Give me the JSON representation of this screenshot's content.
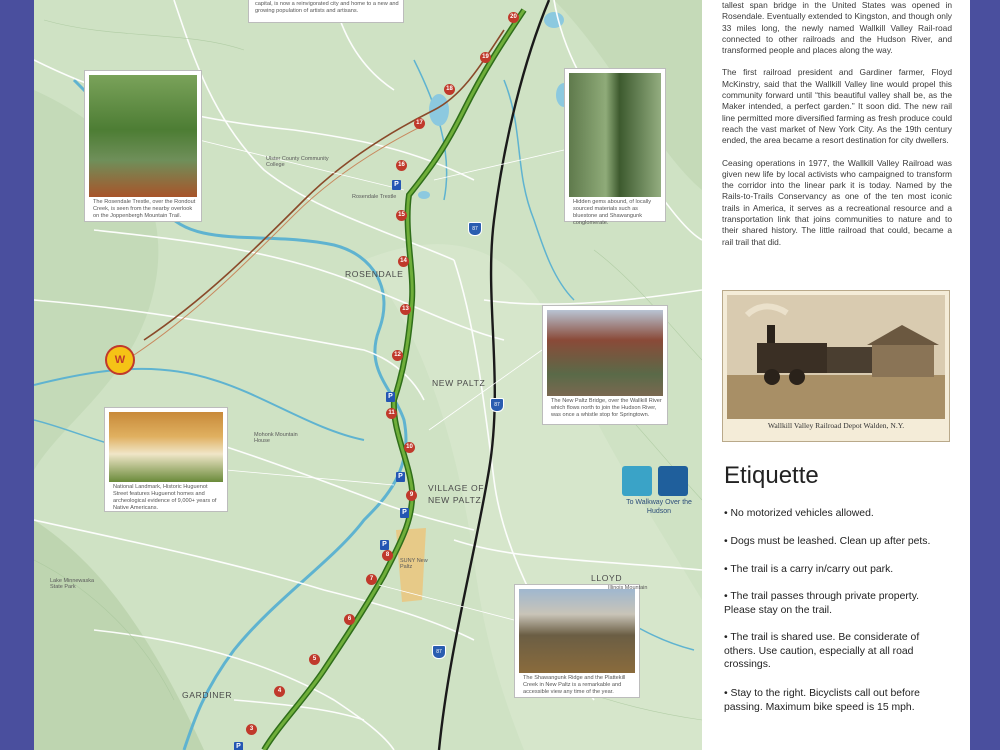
{
  "colors": {
    "border": "#4a4f9e",
    "terrain": "#cfe2c4",
    "trail": "#4f8a2b",
    "river": "#5fb3d0",
    "highway": "#1a1a1a",
    "rail_old": "#8a4a2a",
    "milemarker": "#c0392b",
    "parking": "#2456b3"
  },
  "top_caption": "capital, is now a reinvigorated city and home to a new and growing population of artists and artisans.",
  "story": [
    "tallest span bridge in the United States was opened in Rosendale. Eventually extended to Kingston, and though only 33 miles long, the newly named Wallkill Valley Rail-road connected to other railroads and the Hudson River, and transformed people and places along the way.",
    "The first railroad president and Gardiner farmer, Floyd McKinstry, said that the Wallkill Valley line would propel this community forward until “this beautiful valley shall be, as the Maker intended, a perfect garden.” It soon did. The new rail line permitted more diversified farming as fresh produce could reach the vast market of New York City. As the 19th century ended, the area became a resort destination for city dwellers.",
    "Ceasing operations in 1977, the Wallkill Valley Railroad was given new life by local activists who campaigned to transform the corridor into the linear park it is today. Named by the Rails-to-Trails Conservancy as one of the ten most iconic trails in America, it serves as a recreational resource and a transportation link that joins communities to nature and to their shared history. The little railroad that could, became a rail trail that did."
  ],
  "depot_caption": "Wallkill Valley Railroad Depot    Walden, N.Y.",
  "etiquette": {
    "title": "Etiquette",
    "rules": [
      "• No motorized vehicles allowed.",
      "• Dogs must be leashed. Clean up after pets.",
      "• The trail is a carry in/carry out park.",
      "• The trail passes through private property. Please stay on the trail.",
      "• The trail is shared use. Be considerate of others. Use caution, especially at all road crossings.",
      "• Stay to the right. Bicyclists call out before passing. Maximum bike speed is 15 mph."
    ]
  },
  "callouts": {
    "rosendale_trestle": "The Rosendale Trestle, over the Rondout Creek, is seen from the nearby overlook on the Joppenbergh Mountain Trail.",
    "hidden_gems": "Hidden gems abound, of locally sourced materials such as bluestone and Shawangunk conglomerate.",
    "new_paltz_bridge": "The New Paltz Bridge, over the Wallkill River which flows north to join the Hudson River, was once a whistle stop for Springtown.",
    "huguenot": "National Landmark, Historic Huguenot Street features Huguenot homes and archeological evidence of 9,000+ years of Native Americans.",
    "shawangunk": "The Shawangunk Ridge and the Plattekill Creek in New Paltz is a remarkable and accessible view any time of the year."
  },
  "places": {
    "rosendale": "ROSENDALE",
    "new_paltz": "NEW PALTZ",
    "village_line1": "VILLAGE OF",
    "village_line2": "NEW PALTZ",
    "lloyd": "LLOYD",
    "gardiner": "GARDINER",
    "community_college": "Ulster County Community College",
    "rosendale_trestle": "Rosendale Trestle",
    "lake_minnewaska": "Lake Minnewaska State Park",
    "suny": "SUNY New Paltz",
    "illinois_mountain": "Illinois Mountain",
    "mohonk": "Mohonk Mountain House"
  },
  "walkway": {
    "icon_label": "WALKWAY OVER THE HUDSON",
    "text": "To Walkway Over the Hudson"
  },
  "badge": "W",
  "interstate": "87",
  "mile_markers": [
    "20",
    "19",
    "18",
    "17",
    "16",
    "15",
    "14",
    "13",
    "12",
    "11",
    "10",
    "9",
    "8",
    "7",
    "6",
    "5",
    "4",
    "3"
  ]
}
